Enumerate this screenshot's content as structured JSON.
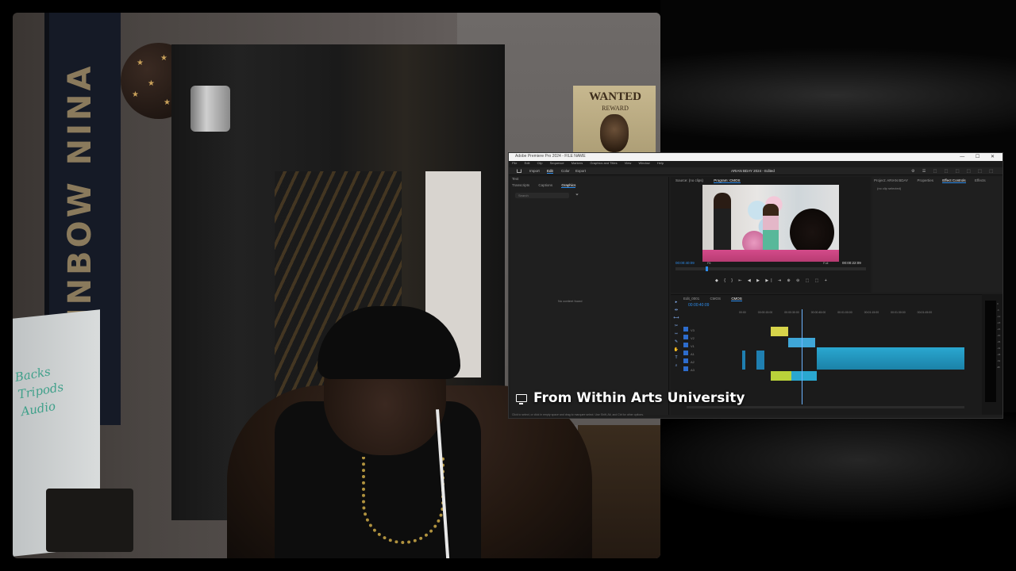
{
  "webcam": {
    "banner_text": "RAINBOW NINA",
    "poster_title": "WANTED",
    "poster_sub": "REWARD",
    "whiteboard_lines": [
      "Tripods",
      "Audio",
      "Backs"
    ]
  },
  "premiere": {
    "titlebar": "Adobe Premiere Pro 2024 - FILE NAME",
    "window_buttons": "— ☐ ✕",
    "menu": [
      "File",
      "Edit",
      "Clip",
      "Sequence",
      "Markers",
      "Graphics and Titles",
      "View",
      "Window",
      "Help"
    ],
    "workspaces": {
      "import": "Import",
      "edit": "Edit",
      "color": "Color",
      "export": "Export"
    },
    "project_title": "ARIAN BDAY 2024 - Edited",
    "left_panel": {
      "tabs": [
        "Transcripts",
        "Captions",
        "Graphics"
      ],
      "active_tab": "Graphics",
      "header": "Text",
      "search_placeholder": "Search",
      "empty_message": "No content found"
    },
    "monitor": {
      "tabs": [
        "Source: (no clips)",
        "Program: CMOS"
      ],
      "timecode_left": "00:00:40:09",
      "timecode_right": "00:00:22:09",
      "fit": "Fit",
      "full": "Full"
    },
    "right_panel": {
      "tabs": [
        "Project: ARIAN BDAY",
        "Properties",
        "Effect Controls",
        "Effects"
      ],
      "active_tab": "Effect Controls",
      "empty_message": "(no clip selected)"
    },
    "timeline": {
      "tabs": [
        "Edit_0001",
        "CMOS",
        "CMOS"
      ],
      "active_tab": "CMOS",
      "timecode": "00:00:40:09",
      "ruler": [
        "00:00",
        "00:00:15:00",
        "00:00:30:00",
        "00:00:45:00",
        "00:01:00:00",
        "00:01:15:00",
        "00:01:30:00",
        "00:01:45:00"
      ],
      "tracks": [
        "V3",
        "V2",
        "V1",
        "A1",
        "A2",
        "A3"
      ]
    },
    "hint": "Click to select, or click in empty space and drag to marquee select. Use Shift, Alt, and Ctrl for other options.",
    "meter_scale": [
      "0",
      "-6",
      "-12",
      "-18",
      "-24",
      "-30",
      "-36",
      "-42",
      "-48",
      "-54",
      "dB"
    ]
  },
  "caption": {
    "text": "From Within Arts University"
  }
}
